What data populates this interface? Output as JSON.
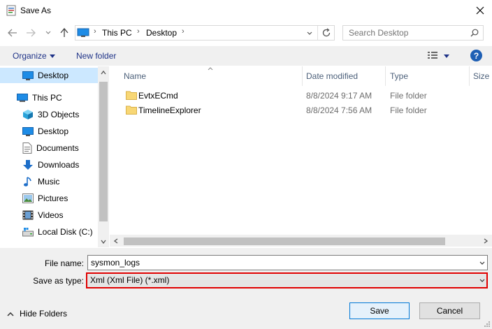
{
  "window": {
    "title": "Save As"
  },
  "address": {
    "crumbs": [
      "This PC",
      "Desktop"
    ]
  },
  "search": {
    "placeholder": "Search Desktop"
  },
  "toolbar": {
    "organize": "Organize",
    "new_folder": "New folder",
    "help": "?"
  },
  "nav": {
    "quick": "Desktop",
    "this_pc": "This PC",
    "items": [
      "3D Objects",
      "Desktop",
      "Documents",
      "Downloads",
      "Music",
      "Pictures",
      "Videos",
      "Local Disk (C:)"
    ]
  },
  "columns": {
    "name": "Name",
    "date": "Date modified",
    "type": "Type",
    "size": "Size"
  },
  "files": [
    {
      "name": "EvtxECmd",
      "date": "8/8/2024 9:17 AM",
      "type": "File folder"
    },
    {
      "name": "TimelineExplorer",
      "date": "8/8/2024 7:56 AM",
      "type": "File folder"
    }
  ],
  "form": {
    "filename_label": "File name:",
    "filename_value": "sysmon_logs",
    "type_label": "Save as type:",
    "type_value": "Xml (Xml File) (*.xml)",
    "highlight_color": "#e00000"
  },
  "footer": {
    "hide_folders": "Hide Folders",
    "save": "Save",
    "cancel": "Cancel"
  },
  "colors": {
    "accent": "#0078d7",
    "folder": "#f8d775",
    "link": "#1e3287"
  }
}
